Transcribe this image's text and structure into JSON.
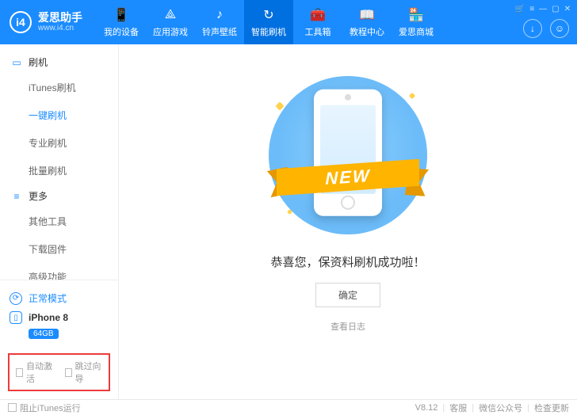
{
  "brand": {
    "name": "爱思助手",
    "url": "www.i4.cn",
    "logo_text": "i4"
  },
  "nav": [
    {
      "label": "我的设备",
      "icon": "📱"
    },
    {
      "label": "应用游戏",
      "icon": "⟁"
    },
    {
      "label": "铃声壁纸",
      "icon": "♪"
    },
    {
      "label": "智能刷机",
      "icon": "↻",
      "active": true
    },
    {
      "label": "工具箱",
      "icon": "🧰"
    },
    {
      "label": "教程中心",
      "icon": "📖"
    },
    {
      "label": "爱思商城",
      "icon": "🏪"
    }
  ],
  "sidebar": {
    "groups": [
      {
        "title": "刷机",
        "icon": "▭",
        "items": [
          {
            "label": "iTunes刷机"
          },
          {
            "label": "一键刷机",
            "active": true
          },
          {
            "label": "专业刷机"
          },
          {
            "label": "批量刷机"
          }
        ]
      },
      {
        "title": "更多",
        "icon": "≡",
        "items": [
          {
            "label": "其他工具"
          },
          {
            "label": "下载固件"
          },
          {
            "label": "高级功能"
          }
        ]
      }
    ],
    "mode": {
      "label": "正常模式"
    },
    "device": {
      "name": "iPhone 8",
      "capacity": "64GB"
    },
    "options": [
      {
        "label": "自动激活"
      },
      {
        "label": "跳过向导"
      }
    ]
  },
  "main": {
    "ribbon": "NEW",
    "message": "恭喜您，保资料刷机成功啦！",
    "ok": "确定",
    "view_log": "查看日志"
  },
  "status": {
    "block_itunes": "阻止iTunes运行",
    "version": "V8.12",
    "support": "客服",
    "wechat": "微信公众号",
    "check_update": "检查更新"
  }
}
